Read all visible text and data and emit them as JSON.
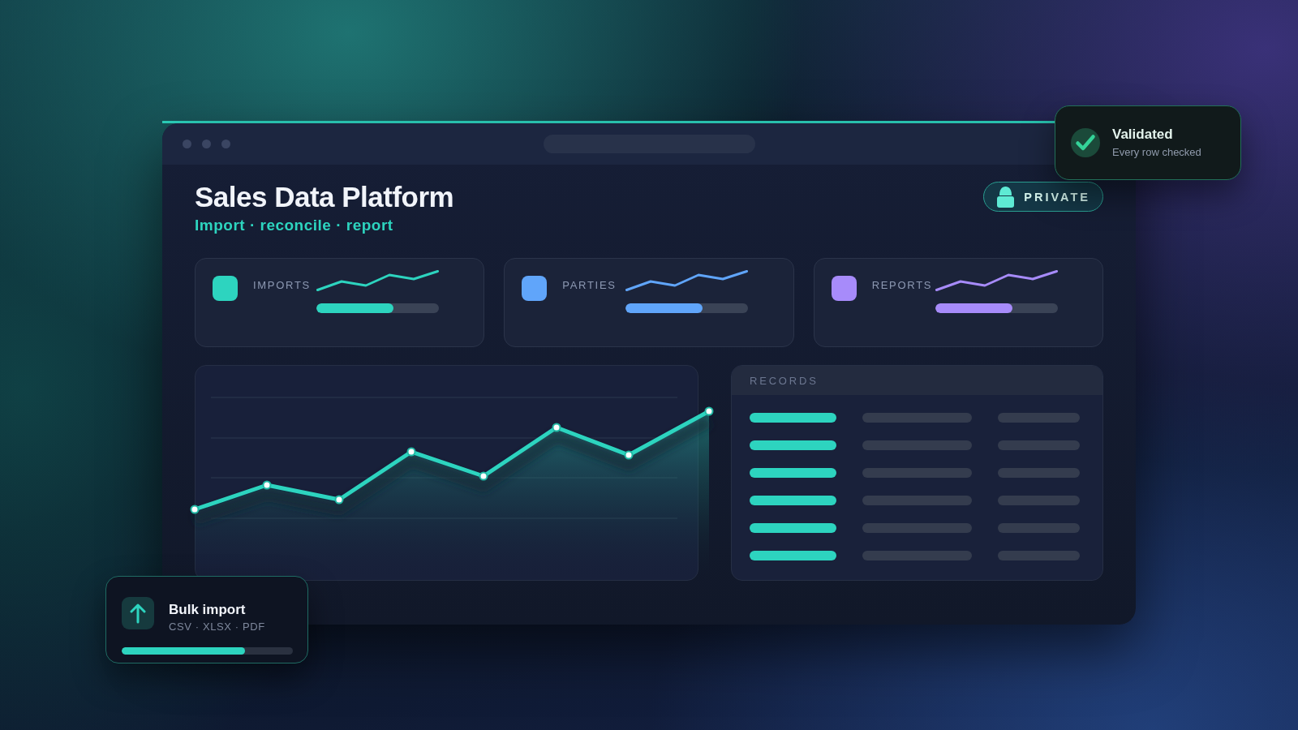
{
  "validation_toast": {
    "title": "Validated",
    "detail": "Every row checked"
  },
  "header": {
    "title": "Sales Data Platform",
    "subtitle": "Import · reconcile · report",
    "badge": "PRIVATE"
  },
  "stats": [
    {
      "label": "IMPORTS",
      "color": "#2dd4bf",
      "level": 0.63
    },
    {
      "label": "PARTIES",
      "color": "#60a5fa",
      "level": 0.63
    },
    {
      "label": "REPORTS",
      "color": "#a78bfa",
      "level": 0.63
    }
  ],
  "records": {
    "title": "RECORDS"
  },
  "upload_card": {
    "title": "Bulk import",
    "formats": "CSV · XLSX · PDF",
    "level": 0.72
  }
}
